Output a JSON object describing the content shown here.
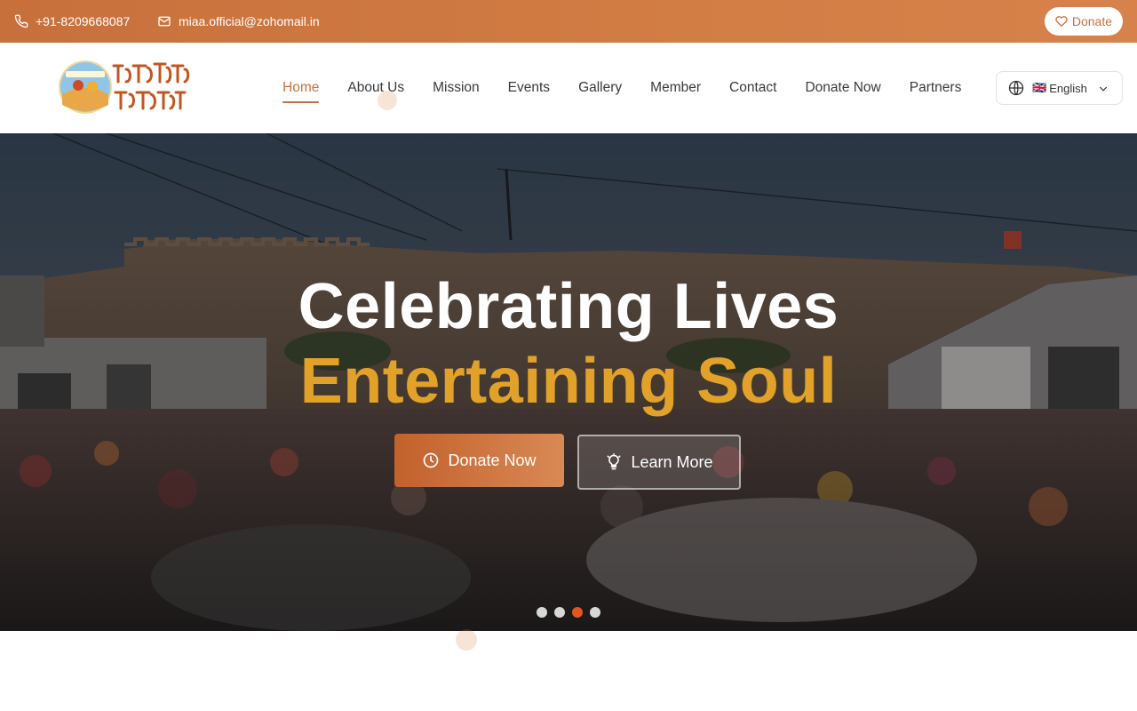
{
  "topbar": {
    "phone": "+91-8209668087",
    "email": "miaa.official@zohomail.in",
    "donate_label": "Donate",
    "icons": [
      "phone-icon",
      "mail-icon",
      "heart-icon"
    ]
  },
  "header": {
    "logo_alt": "Marudhara Antarrashtriya Manoranjan Sangh logo",
    "nav": [
      {
        "label": "Home",
        "active": true
      },
      {
        "label": "About Us"
      },
      {
        "label": "Mission"
      },
      {
        "label": "Events"
      },
      {
        "label": "Gallery"
      },
      {
        "label": "Member"
      },
      {
        "label": "Contact"
      },
      {
        "label": "Donate Now"
      },
      {
        "label": "Partners"
      }
    ],
    "language": {
      "flag": "🇬🇧",
      "selected": "English",
      "icons": [
        "globe-icon",
        "chevron-down-icon"
      ]
    }
  },
  "hero": {
    "title_line1": "Celebrating Lives",
    "title_line2": "Entertaining Soul",
    "donate_button": "Donate Now",
    "learn_button": "Learn More",
    "slides": 4,
    "active_slide": 3
  },
  "colors": {
    "brand": "#c8703c",
    "accent_gold": "#e2a22a",
    "active_dot": "#e0581f"
  }
}
